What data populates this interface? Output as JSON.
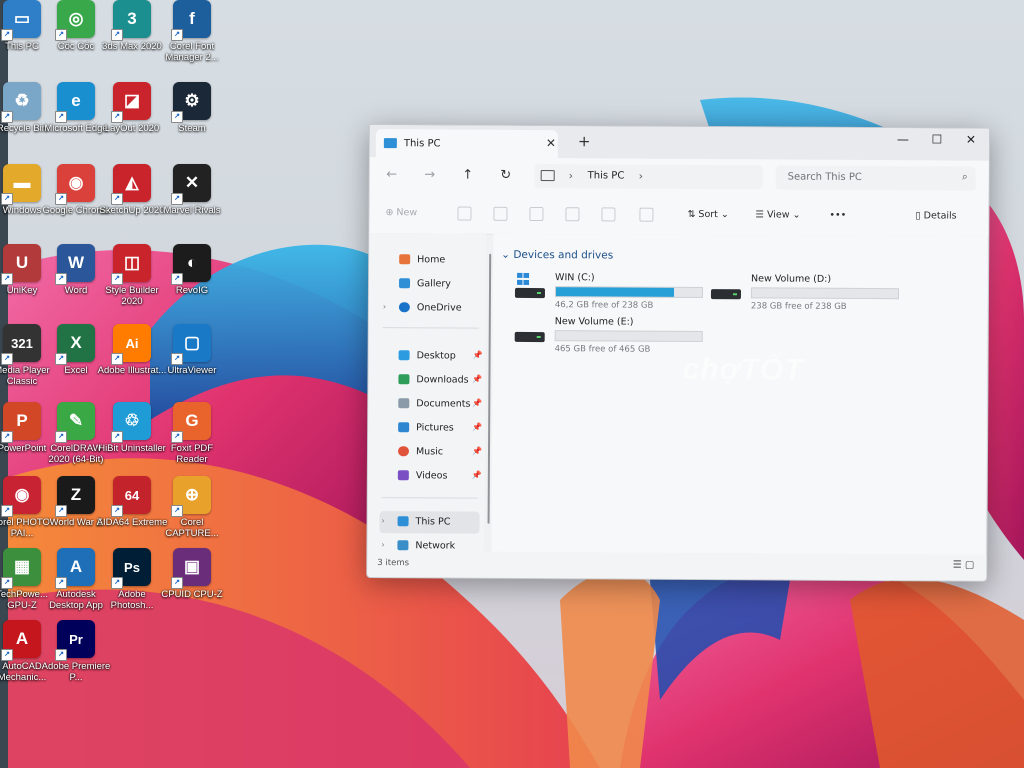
{
  "desktop": {
    "icons": [
      {
        "label": "This PC",
        "color": "#2f7fc8",
        "glyph": "▭"
      },
      {
        "label": "Cốc Cốc",
        "color": "#39a84a",
        "glyph": "◎"
      },
      {
        "label": "3ds Max 2020",
        "color": "#1b8f8f",
        "glyph": "3"
      },
      {
        "label": "Corel Font Manager 2...",
        "color": "#1d5e9c",
        "glyph": "f"
      },
      {
        "label": "Recycle Bin",
        "color": "#7aa6c8",
        "glyph": "♻"
      },
      {
        "label": "Microsoft Edge",
        "color": "#1a8fd0",
        "glyph": "e"
      },
      {
        "label": "LayOut 2020",
        "color": "#c9242c",
        "glyph": "◪"
      },
      {
        "label": "Steam",
        "color": "#1b2838",
        "glyph": "⚙"
      },
      {
        "label": "Windows",
        "color": "#e3a92a",
        "glyph": "▬"
      },
      {
        "label": "Google Chrome",
        "color": "#d9413a",
        "glyph": "◉"
      },
      {
        "label": "SketchUp 2020",
        "color": "#c9242c",
        "glyph": "◭"
      },
      {
        "label": "Marvel Rivals",
        "color": "#222222",
        "glyph": "✕"
      },
      {
        "label": "UniKey",
        "color": "#b23a3a",
        "glyph": "U"
      },
      {
        "label": "Word",
        "color": "#2b579a",
        "glyph": "W"
      },
      {
        "label": "Style Builder 2020",
        "color": "#c9242c",
        "glyph": "◫"
      },
      {
        "label": "RevoIG",
        "color": "#1c1c1c",
        "glyph": "◐"
      },
      {
        "label": "Media Player Classic",
        "color": "#333333",
        "glyph": "321"
      },
      {
        "label": "Excel",
        "color": "#217346",
        "glyph": "X"
      },
      {
        "label": "Adobe Illustrat...",
        "color": "#ff7c00",
        "glyph": "Ai"
      },
      {
        "label": "UltraViewer",
        "color": "#1a79c7",
        "glyph": "▢"
      },
      {
        "label": "PowerPoint",
        "color": "#d24726",
        "glyph": "P"
      },
      {
        "label": "CorelDRAW 2020 (64-Bit)",
        "color": "#3aa845",
        "glyph": "✎"
      },
      {
        "label": "HiBit Uninstaller",
        "color": "#1f9bd6",
        "glyph": "♲"
      },
      {
        "label": "Foxit PDF Reader",
        "color": "#e8642c",
        "glyph": "G"
      },
      {
        "label": "Corel PHOTO-PAI...",
        "color": "#c82333",
        "glyph": "◉"
      },
      {
        "label": "World War Z",
        "color": "#1a1a1a",
        "glyph": "Z"
      },
      {
        "label": "AIDA64 Extreme",
        "color": "#c3242c",
        "glyph": "64"
      },
      {
        "label": "Corel CAPTURE...",
        "color": "#e8a12a",
        "glyph": "⊕"
      },
      {
        "label": "TechPowe... GPU-Z",
        "color": "#3c8f3c",
        "glyph": "▦"
      },
      {
        "label": "Autodesk Desktop App",
        "color": "#1e6fb8",
        "glyph": "A"
      },
      {
        "label": "Adobe Photosh...",
        "color": "#001e36",
        "glyph": "Ps"
      },
      {
        "label": "CPUID CPU-Z",
        "color": "#6a2d7a",
        "glyph": "▣"
      },
      {
        "label": "AutoCAD Mechanic...",
        "color": "#c4161c",
        "glyph": "A"
      },
      {
        "label": "Adobe Premiere P...",
        "color": "#00005b",
        "glyph": "Pr"
      }
    ]
  },
  "window": {
    "tab_title": "This PC",
    "tab_close": "✕",
    "new_tab": "+",
    "controls": {
      "minimize": "—",
      "maximize": "☐",
      "close": "✕"
    },
    "nav": {
      "back": "←",
      "forward": "→",
      "up": "↑",
      "refresh": "↻"
    },
    "breadcrumb": "This PC",
    "search_placeholder": "Search This PC",
    "commands": {
      "new": "New",
      "sort": "Sort",
      "view": "View",
      "more": "•••",
      "details": "Details"
    },
    "sidebar": {
      "home": "Home",
      "gallery": "Gallery",
      "onedrive": "OneDrive",
      "desktop": "Desktop",
      "downloads": "Downloads",
      "documents": "Documents",
      "pictures": "Pictures",
      "music": "Music",
      "videos": "Videos",
      "thispc": "This PC",
      "network": "Network"
    },
    "group_header": "Devices and drives",
    "drives": [
      {
        "name": "WIN (C:)",
        "free": "46,2 GB free of 238 GB",
        "used_percent": 80.6
      },
      {
        "name": "New Volume (D:)",
        "free": "238 GB free of 238 GB",
        "used_percent": 0
      },
      {
        "name": "New Volume (E:)",
        "free": "465 GB free of 465 GB",
        "used_percent": 0
      }
    ],
    "status_count": "3 items",
    "watermark": "chợTỐT"
  }
}
